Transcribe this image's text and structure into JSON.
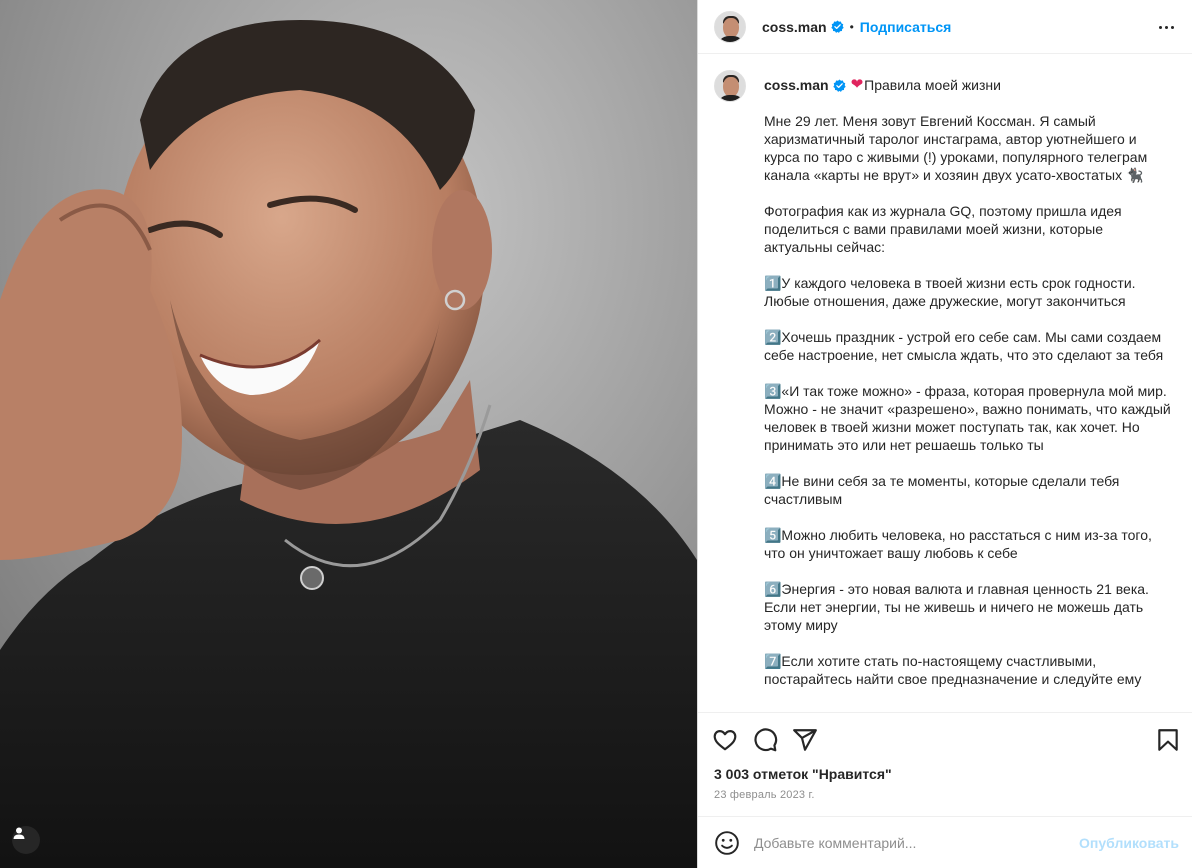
{
  "post": {
    "username": "coss.man",
    "separator": "•",
    "follow_label": "Подписаться",
    "caption_title": "Правила моей жизни",
    "caption_emoji": "❤",
    "paragraphs": [
      "Мне 29 лет. Меня зовут Евгений Коссман. Я самый харизматичный таролог инстаграма, автор уютнейшего и курса по таро с живыми (!) уроками, популярного телеграм канала «карты не врут» и хозяин двух усато-хвостатых 🐈‍⬛",
      "Фотография как из журнала GQ, поэтому пришла идея поделиться с вами правилами моей жизни, которые актуальны сейчас:",
      "1️⃣У каждого человека в твоей жизни есть срок годности. Любые отношения, даже дружеские, могут закончиться",
      "2️⃣Хочешь праздник - устрой его себе сам. Мы сами создаем себе настроение, нет смысла ждать, что это сделают за тебя",
      "3️⃣«И так тоже можно» - фраза, которая провернула мой мир. Можно - не значит «разрешено», важно понимать, что каждый человек в твоей жизни может поступать так, как хочет. Но принимать это или нет решаешь только ты",
      "4️⃣Не вини себя за те моменты, которые сделали тебя счастливым",
      "5️⃣Можно любить человека, но расстаться с ним из-за того, что он уничтожает вашу любовь к себе",
      "6️⃣Энергия - это новая валюта и главная ценность 21 века. Если нет энергии, ты не живешь и ничего не можешь дать этому миру",
      "7️⃣Если хотите стать по-настоящему счастливыми, постарайтесь найти свое предназначение и следуйте ему"
    ],
    "likes": "3 003 отметок \"Нравится\"",
    "date": "23 февраль 2023 г.",
    "comment_placeholder": "Добавьте комментарий...",
    "publish_label": "Опубликовать"
  },
  "icons": {
    "verified": "verified-badge-icon",
    "more": "more-options-icon",
    "like": "heart-icon",
    "comment": "comment-icon",
    "share": "paper-plane-icon",
    "save": "bookmark-icon",
    "emoji": "emoji-icon",
    "tag": "user-tag-icon"
  },
  "colors": {
    "link_blue": "#0095f6",
    "publish_disabled": "#b2dffc",
    "muted": "#8e8e8e"
  }
}
